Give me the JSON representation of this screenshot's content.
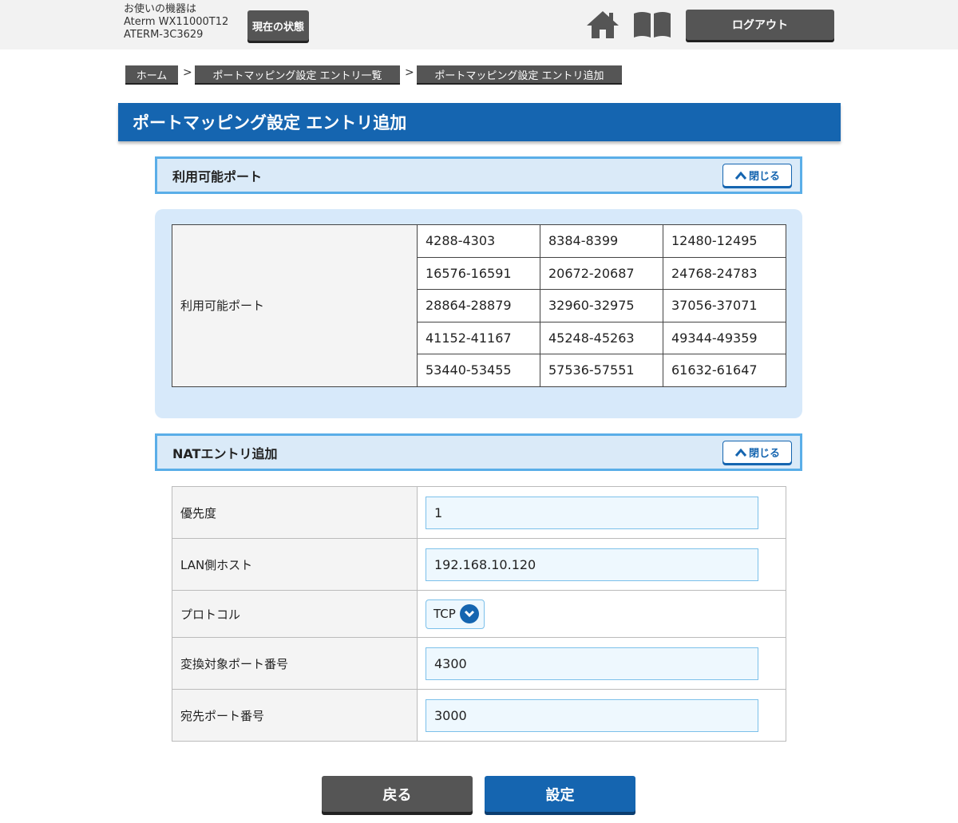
{
  "header": {
    "device_line1": "お使いの機器は",
    "device_line2": "Aterm WX11000T12",
    "device_line3": "ATERM-3C3629",
    "status_button": "現在の状態",
    "logout_button": "ログアウト",
    "icons": [
      "home-icon",
      "manual-icon"
    ]
  },
  "breadcrumb": {
    "items": [
      "ホーム",
      "ポートマッピング設定 エントリ一覧",
      "ポートマッピング設定 エントリ追加"
    ],
    "separator": ">"
  },
  "page_title": "ポートマッピング設定 エントリ追加",
  "available_ports": {
    "section_title": "利用可能ポート",
    "close_label": "閉じる",
    "row_label": "利用可能ポート",
    "ports": [
      [
        "4288-4303",
        "8384-8399",
        "12480-12495"
      ],
      [
        "16576-16591",
        "20672-20687",
        "24768-24783"
      ],
      [
        "28864-28879",
        "32960-32975",
        "37056-37071"
      ],
      [
        "41152-41167",
        "45248-45263",
        "49344-49359"
      ],
      [
        "53440-53455",
        "57536-57551",
        "61632-61647"
      ]
    ]
  },
  "nat_entry": {
    "section_title": "NATエントリ追加",
    "close_label": "閉じる",
    "fields": {
      "priority": {
        "label": "優先度",
        "value": "1"
      },
      "lan_host": {
        "label": "LAN側ホスト",
        "value": "192.168.10.120"
      },
      "protocol": {
        "label": "プロトコル",
        "value": "TCP"
      },
      "translated_port": {
        "label": "変換対象ポート番号",
        "value": "4300"
      },
      "destination_port": {
        "label": "宛先ポート番号",
        "value": "3000"
      }
    }
  },
  "buttons": {
    "back": "戻る",
    "submit": "設定"
  },
  "colors": {
    "accent_blue": "#1565b0",
    "section_border": "#5aaee8",
    "section_bg": "#daeaf8",
    "dark_button": "#555555"
  }
}
